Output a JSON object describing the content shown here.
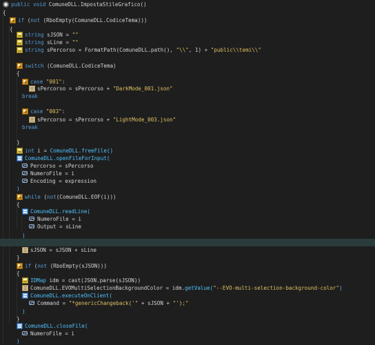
{
  "editor": {
    "background": "#1e1e1e",
    "highlight_line_color": "#2a3b3b",
    "token_colors": {
      "keyword": "#569cd6",
      "string": "#e0c060",
      "function": "#4fc1ff",
      "text": "#d4d4d4"
    },
    "lines": [
      {
        "icon": "function-icon",
        "segments": [
          [
            "k",
            "public void "
          ],
          [
            "v",
            "ComuneDLL.ImpostaStileGrafico()"
          ]
        ]
      },
      {
        "icon": "",
        "segments": [
          [
            "v",
            "{"
          ]
        ]
      },
      {
        "icon": "block-icon",
        "segments": [
          [
            "k",
            "if "
          ],
          [
            "v",
            "("
          ],
          [
            "k",
            "not "
          ],
          [
            "v",
            "(RboEmpty(ComuneDLL.CodiceTema)))"
          ]
        ]
      },
      {
        "icon": "",
        "segments": [
          [
            "v",
            "{"
          ]
        ]
      },
      {
        "icon": "variable-icon",
        "segments": [
          [
            "k",
            "string "
          ],
          [
            "v",
            "sJSON = "
          ],
          [
            "s",
            "\"\""
          ]
        ]
      },
      {
        "icon": "variable-icon",
        "segments": [
          [
            "k",
            "string "
          ],
          [
            "v",
            "sLine = "
          ],
          [
            "s",
            "\"\""
          ]
        ]
      },
      {
        "icon": "variable-icon",
        "segments": [
          [
            "k",
            "string "
          ],
          [
            "v",
            "sPercorso = FormatPath(ComuneDLL.path(), "
          ],
          [
            "s",
            "\"\\\\\""
          ],
          [
            "v",
            ", 1) + "
          ],
          [
            "s",
            "\"public\\\\temi\\\\\""
          ]
        ]
      },
      {
        "icon": "",
        "segments": []
      },
      {
        "icon": "block-icon",
        "segments": [
          [
            "k",
            "switch "
          ],
          [
            "v",
            "(ComuneDLL.CodiceTema)"
          ]
        ]
      },
      {
        "icon": "",
        "segments": [
          [
            "v",
            "{"
          ]
        ]
      },
      {
        "icon": "block-icon",
        "segments": [
          [
            "k",
            "case "
          ],
          [
            "s",
            "\"001\""
          ],
          [
            "v",
            ":"
          ]
        ]
      },
      {
        "icon": "assign-icon",
        "segments": [
          [
            "v",
            "sPercorso = sPercorso + "
          ],
          [
            "s",
            "\"DarkMode_001.json\""
          ]
        ]
      },
      {
        "icon": "",
        "segments": [
          [
            "k",
            "break"
          ]
        ]
      },
      {
        "icon": "",
        "segments": []
      },
      {
        "icon": "block-icon",
        "segments": [
          [
            "k",
            "case "
          ],
          [
            "s",
            "\"003\""
          ],
          [
            "v",
            ":"
          ]
        ]
      },
      {
        "icon": "assign-icon",
        "segments": [
          [
            "v",
            "sPercorso = sPercorso + "
          ],
          [
            "s",
            "\"LightMode_003.json\""
          ]
        ]
      },
      {
        "icon": "",
        "segments": [
          [
            "k",
            "break"
          ]
        ]
      },
      {
        "icon": "",
        "segments": []
      },
      {
        "icon": "",
        "segments": [
          [
            "v",
            "}"
          ]
        ]
      },
      {
        "icon": "variable-icon",
        "segments": [
          [
            "k",
            "int "
          ],
          [
            "v",
            "i = "
          ],
          [
            "f",
            "ComuneDLL.freeFile()"
          ]
        ]
      },
      {
        "icon": "call-icon",
        "segments": [
          [
            "f",
            "ComuneDLL.openFileForInput("
          ]
        ]
      },
      {
        "icon": "param-icon",
        "segments": [
          [
            "v",
            "Percorso = sPercorso"
          ]
        ]
      },
      {
        "icon": "param-icon",
        "segments": [
          [
            "v",
            "NumeroFile = i"
          ]
        ]
      },
      {
        "icon": "param-icon",
        "segments": [
          [
            "v",
            "Encoding = expression"
          ]
        ]
      },
      {
        "icon": "",
        "segments": [
          [
            "f",
            ")"
          ]
        ]
      },
      {
        "icon": "block-icon",
        "segments": [
          [
            "k",
            "while "
          ],
          [
            "v",
            "("
          ],
          [
            "k",
            "not"
          ],
          [
            "v",
            "(ComuneDLL.EOF(i)))"
          ]
        ]
      },
      {
        "icon": "",
        "segments": [
          [
            "v",
            "{"
          ]
        ]
      },
      {
        "icon": "call-icon",
        "segments": [
          [
            "f",
            "ComuneDLL.readLine("
          ]
        ]
      },
      {
        "icon": "param-icon",
        "segments": [
          [
            "v",
            "NumeroFile = i"
          ]
        ]
      },
      {
        "icon": "param-icon",
        "segments": [
          [
            "v",
            "Output = sLine"
          ]
        ]
      },
      {
        "icon": "",
        "segments": [
          [
            "f",
            ")"
          ]
        ]
      },
      {
        "icon": "",
        "segments": [],
        "highlight": true
      },
      {
        "icon": "assign-icon",
        "segments": [
          [
            "v",
            "sJSON = sJSON + sLine"
          ]
        ]
      },
      {
        "icon": "",
        "segments": [
          [
            "v",
            "}"
          ]
        ]
      },
      {
        "icon": "block-icon",
        "segments": [
          [
            "k",
            "if "
          ],
          [
            "v",
            "("
          ],
          [
            "k",
            "not "
          ],
          [
            "v",
            "(RboEmpty(sJSON)))"
          ]
        ]
      },
      {
        "icon": "",
        "segments": [
          [
            "v",
            "{"
          ]
        ]
      },
      {
        "icon": "variable-icon",
        "segments": [
          [
            "f",
            "IDMap "
          ],
          [
            "v",
            "idm = cast(JSON.parse(sJSON))"
          ]
        ]
      },
      {
        "icon": "assign-icon",
        "segments": [
          [
            "v",
            "ComuneDLL.EVOMultiSelectionBackgroundColor = idm."
          ],
          [
            "f",
            "getValue("
          ],
          [
            "s",
            "\"--EVO-multi-selection-background-color\""
          ],
          [
            "f",
            ")"
          ]
        ]
      },
      {
        "icon": "call-icon",
        "segments": [
          [
            "f",
            "ComuneDLL.executeOnClient("
          ]
        ]
      },
      {
        "icon": "param-icon",
        "segments": [
          [
            "v",
            "Command = "
          ],
          [
            "s",
            "\"*genericChangeback('\""
          ],
          [
            "v",
            " + sJSON + "
          ],
          [
            "s",
            "\"');\""
          ]
        ]
      },
      {
        "icon": "",
        "segments": [
          [
            "f",
            ")"
          ]
        ]
      },
      {
        "icon": "",
        "segments": [
          [
            "v",
            "}"
          ]
        ]
      },
      {
        "icon": "call-icon",
        "segments": [
          [
            "f",
            "ComuneDLL.closeFile("
          ]
        ]
      },
      {
        "icon": "param-icon",
        "segments": [
          [
            "v",
            "NumeroFile = i"
          ]
        ]
      },
      {
        "icon": "",
        "segments": [
          [
            "f",
            ")"
          ]
        ]
      }
    ]
  }
}
